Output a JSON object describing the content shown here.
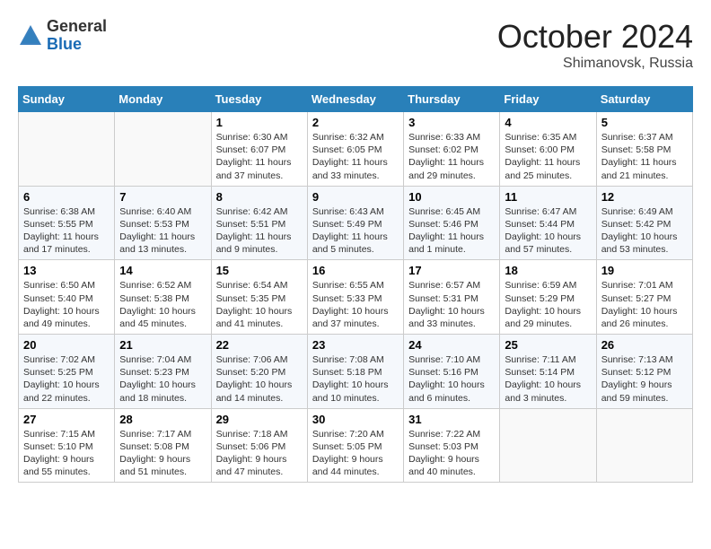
{
  "header": {
    "logo_general": "General",
    "logo_blue": "Blue",
    "month": "October 2024",
    "location": "Shimanovsk, Russia"
  },
  "weekdays": [
    "Sunday",
    "Monday",
    "Tuesday",
    "Wednesday",
    "Thursday",
    "Friday",
    "Saturday"
  ],
  "weeks": [
    [
      {
        "day": "",
        "info": ""
      },
      {
        "day": "",
        "info": ""
      },
      {
        "day": "1",
        "info": "Sunrise: 6:30 AM\nSunset: 6:07 PM\nDaylight: 11 hours and 37 minutes."
      },
      {
        "day": "2",
        "info": "Sunrise: 6:32 AM\nSunset: 6:05 PM\nDaylight: 11 hours and 33 minutes."
      },
      {
        "day": "3",
        "info": "Sunrise: 6:33 AM\nSunset: 6:02 PM\nDaylight: 11 hours and 29 minutes."
      },
      {
        "day": "4",
        "info": "Sunrise: 6:35 AM\nSunset: 6:00 PM\nDaylight: 11 hours and 25 minutes."
      },
      {
        "day": "5",
        "info": "Sunrise: 6:37 AM\nSunset: 5:58 PM\nDaylight: 11 hours and 21 minutes."
      }
    ],
    [
      {
        "day": "6",
        "info": "Sunrise: 6:38 AM\nSunset: 5:55 PM\nDaylight: 11 hours and 17 minutes."
      },
      {
        "day": "7",
        "info": "Sunrise: 6:40 AM\nSunset: 5:53 PM\nDaylight: 11 hours and 13 minutes."
      },
      {
        "day": "8",
        "info": "Sunrise: 6:42 AM\nSunset: 5:51 PM\nDaylight: 11 hours and 9 minutes."
      },
      {
        "day": "9",
        "info": "Sunrise: 6:43 AM\nSunset: 5:49 PM\nDaylight: 11 hours and 5 minutes."
      },
      {
        "day": "10",
        "info": "Sunrise: 6:45 AM\nSunset: 5:46 PM\nDaylight: 11 hours and 1 minute."
      },
      {
        "day": "11",
        "info": "Sunrise: 6:47 AM\nSunset: 5:44 PM\nDaylight: 10 hours and 57 minutes."
      },
      {
        "day": "12",
        "info": "Sunrise: 6:49 AM\nSunset: 5:42 PM\nDaylight: 10 hours and 53 minutes."
      }
    ],
    [
      {
        "day": "13",
        "info": "Sunrise: 6:50 AM\nSunset: 5:40 PM\nDaylight: 10 hours and 49 minutes."
      },
      {
        "day": "14",
        "info": "Sunrise: 6:52 AM\nSunset: 5:38 PM\nDaylight: 10 hours and 45 minutes."
      },
      {
        "day": "15",
        "info": "Sunrise: 6:54 AM\nSunset: 5:35 PM\nDaylight: 10 hours and 41 minutes."
      },
      {
        "day": "16",
        "info": "Sunrise: 6:55 AM\nSunset: 5:33 PM\nDaylight: 10 hours and 37 minutes."
      },
      {
        "day": "17",
        "info": "Sunrise: 6:57 AM\nSunset: 5:31 PM\nDaylight: 10 hours and 33 minutes."
      },
      {
        "day": "18",
        "info": "Sunrise: 6:59 AM\nSunset: 5:29 PM\nDaylight: 10 hours and 29 minutes."
      },
      {
        "day": "19",
        "info": "Sunrise: 7:01 AM\nSunset: 5:27 PM\nDaylight: 10 hours and 26 minutes."
      }
    ],
    [
      {
        "day": "20",
        "info": "Sunrise: 7:02 AM\nSunset: 5:25 PM\nDaylight: 10 hours and 22 minutes."
      },
      {
        "day": "21",
        "info": "Sunrise: 7:04 AM\nSunset: 5:23 PM\nDaylight: 10 hours and 18 minutes."
      },
      {
        "day": "22",
        "info": "Sunrise: 7:06 AM\nSunset: 5:20 PM\nDaylight: 10 hours and 14 minutes."
      },
      {
        "day": "23",
        "info": "Sunrise: 7:08 AM\nSunset: 5:18 PM\nDaylight: 10 hours and 10 minutes."
      },
      {
        "day": "24",
        "info": "Sunrise: 7:10 AM\nSunset: 5:16 PM\nDaylight: 10 hours and 6 minutes."
      },
      {
        "day": "25",
        "info": "Sunrise: 7:11 AM\nSunset: 5:14 PM\nDaylight: 10 hours and 3 minutes."
      },
      {
        "day": "26",
        "info": "Sunrise: 7:13 AM\nSunset: 5:12 PM\nDaylight: 9 hours and 59 minutes."
      }
    ],
    [
      {
        "day": "27",
        "info": "Sunrise: 7:15 AM\nSunset: 5:10 PM\nDaylight: 9 hours and 55 minutes."
      },
      {
        "day": "28",
        "info": "Sunrise: 7:17 AM\nSunset: 5:08 PM\nDaylight: 9 hours and 51 minutes."
      },
      {
        "day": "29",
        "info": "Sunrise: 7:18 AM\nSunset: 5:06 PM\nDaylight: 9 hours and 47 minutes."
      },
      {
        "day": "30",
        "info": "Sunrise: 7:20 AM\nSunset: 5:05 PM\nDaylight: 9 hours and 44 minutes."
      },
      {
        "day": "31",
        "info": "Sunrise: 7:22 AM\nSunset: 5:03 PM\nDaylight: 9 hours and 40 minutes."
      },
      {
        "day": "",
        "info": ""
      },
      {
        "day": "",
        "info": ""
      }
    ]
  ]
}
